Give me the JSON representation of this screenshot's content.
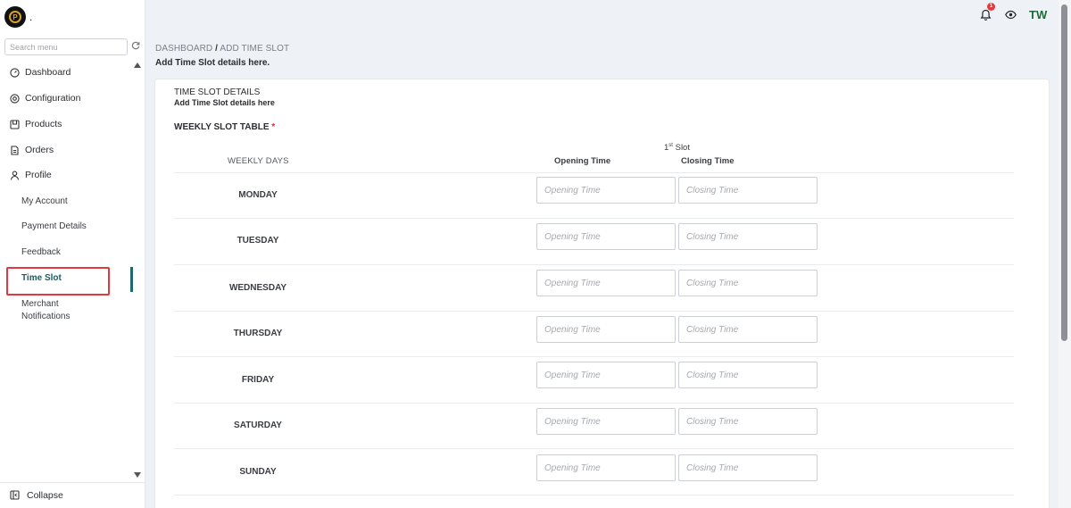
{
  "brand": {
    "dot": "."
  },
  "search": {
    "placeholder": "Search menu"
  },
  "nav": {
    "dashboard": "Dashboard",
    "configuration": "Configuration",
    "products": "Products",
    "orders": "Orders",
    "profile": "Profile",
    "sub": {
      "my_account": "My Account",
      "payment_details": "Payment Details",
      "feedback": "Feedback",
      "time_slot": "Time Slot",
      "merchant_notifications_1": "Merchant",
      "merchant_notifications_2": "Notifications"
    },
    "collapse": "Collapse"
  },
  "header": {
    "notification_count": "1",
    "avatar_initials": "TW"
  },
  "breadcrumb": {
    "root": "DASHBOARD",
    "separator": "/",
    "current": "ADD TIME SLOT",
    "subtitle": "Add Time Slot details here."
  },
  "card": {
    "title": "TIME SLOT DETAILS",
    "subtitle": "Add Time Slot details here",
    "table_label": "WEEKLY SLOT TABLE",
    "required_mark": "*",
    "slot_label_num": "1",
    "slot_label_sup": "st",
    "slot_label_text": "Slot",
    "col_days": "WEEKLY DAYS",
    "col_open": "Opening Time",
    "col_close": "Closing Time",
    "open_placeholder": "Opening Time",
    "close_placeholder": "Closing Time",
    "days": [
      "MONDAY",
      "TUESDAY",
      "WEDNESDAY",
      "THURSDAY",
      "FRIDAY",
      "SATURDAY",
      "SUNDAY"
    ]
  },
  "colors": {
    "accent": "#1c6a70",
    "highlight_box": "#e0393e",
    "badge": "#e33b3b",
    "avatar_text": "#1e6b3a"
  }
}
